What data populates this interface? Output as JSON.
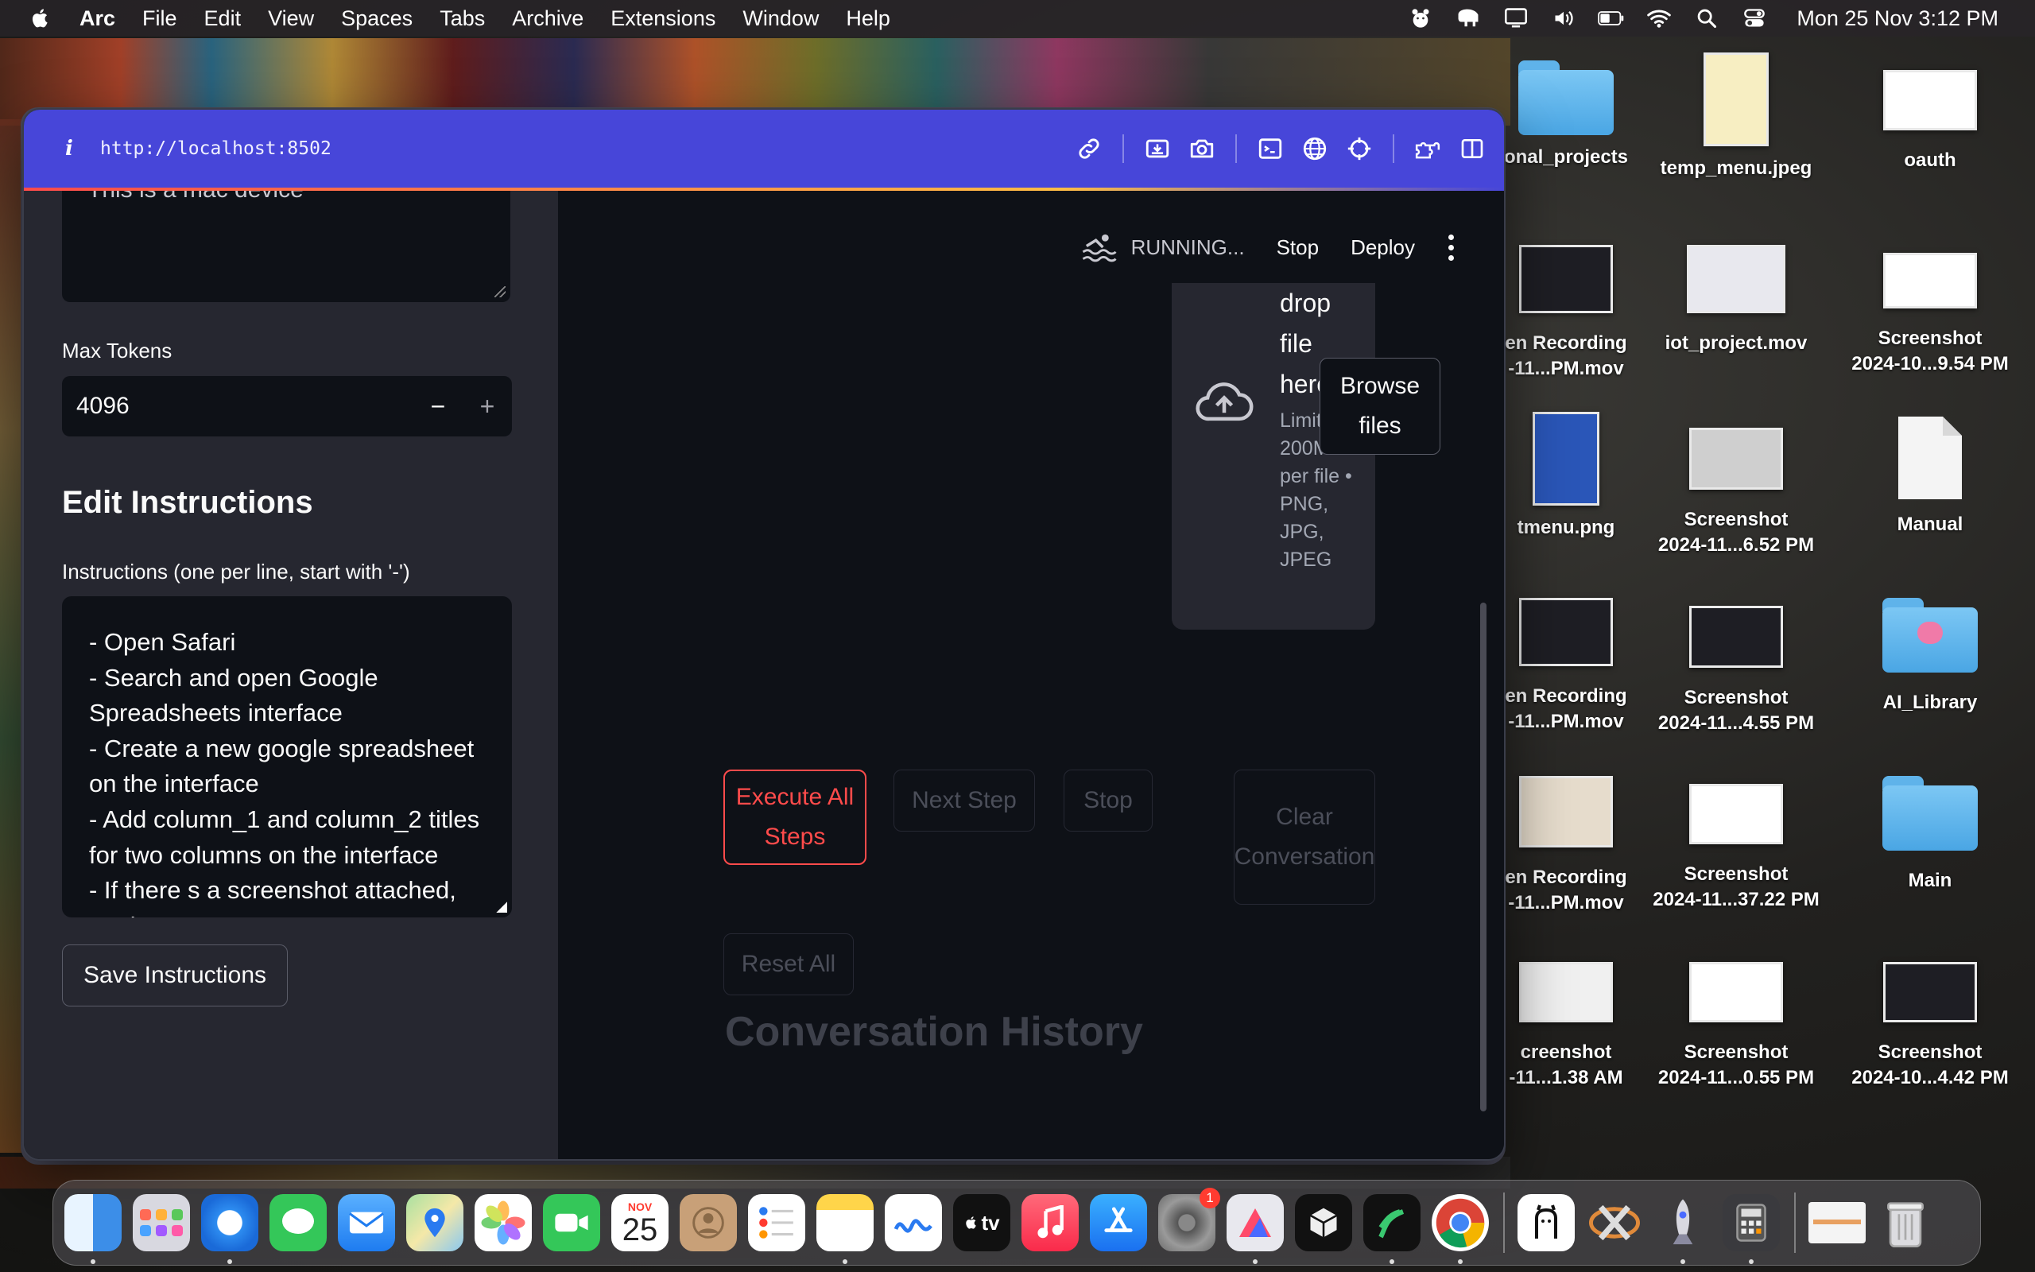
{
  "menubar": {
    "app_name": "Arc",
    "items": [
      "File",
      "Edit",
      "View",
      "Spaces",
      "Tabs",
      "Archive",
      "Extensions",
      "Window",
      "Help"
    ],
    "status_icons": [
      "bear-icon",
      "elephant-icon",
      "display-icon",
      "volume-icon",
      "battery-icon",
      "wifi-icon",
      "spotlight-search-icon",
      "control-center-icon"
    ],
    "clock": "Mon 25 Nov  3:12 PM"
  },
  "browser": {
    "url": "http://localhost:8502",
    "accent": "#4746d9",
    "tools": [
      "link-icon",
      "capture-icon",
      "camera-icon",
      "terminal-icon",
      "globe-icon",
      "crosshair-icon",
      "extensions-icon",
      "sidebar-toggle-icon"
    ]
  },
  "sidebar": {
    "prev_textarea_text": "This is a mac device",
    "max_tokens_label": "Max Tokens",
    "max_tokens_value": "4096",
    "minus": "−",
    "plus": "+",
    "section_title": "Edit Instructions",
    "instructions_label": "Instructions (one per line, start with '-')",
    "instructions_value": "- Open Safari\n- Search and open Google Spreadsheets interface\n- Create a new google spreadsheet on the interface\n- Add column_1 and column_2 titles for two columns on the interface\n- If there s a screenshot attached, analyze",
    "save_button": "Save Instructions"
  },
  "main": {
    "status": {
      "running": "RUNNING...",
      "stop": "Stop",
      "deploy": "Deploy"
    },
    "uploader": {
      "title": "drop file here",
      "limits": "Limit 200MB per file • PNG, JPG, JPEG",
      "browse": "Browse files"
    },
    "buttons": {
      "execute": "Execute All Steps",
      "next": "Next Step",
      "stop": "Stop",
      "clear": "Clear Conversation",
      "reset": "Reset All"
    },
    "conversation_title": "Conversation History",
    "primary_color": "#ff4b4b"
  },
  "desktop": {
    "icons": [
      {
        "name": "onal_projects",
        "kind": "folder"
      },
      {
        "name": "temp_menu.jpeg",
        "kind": "image"
      },
      {
        "name": "oauth",
        "kind": "screenshot"
      },
      {
        "name": "en Recording\n-11...PM.mov",
        "kind": "video"
      },
      {
        "name": "iot_project.mov",
        "kind": "video"
      },
      {
        "name": "Screenshot\n2024-10...9.54 PM",
        "kind": "screenshot"
      },
      {
        "name": "tmenu.png",
        "kind": "image"
      },
      {
        "name": "Screenshot\n2024-11...6.52 PM",
        "kind": "screenshot"
      },
      {
        "name": "Manual",
        "kind": "document"
      },
      {
        "name": "en Recording\n-11...PM.mov",
        "kind": "video"
      },
      {
        "name": "Screenshot\n2024-11...4.55 PM",
        "kind": "screenshot"
      },
      {
        "name": "AI_Library",
        "kind": "folder"
      },
      {
        "name": "en Recording\n-11...PM.mov",
        "kind": "video"
      },
      {
        "name": "Screenshot\n2024-11...37.22 PM",
        "kind": "screenshot"
      },
      {
        "name": "Main",
        "kind": "folder"
      },
      {
        "name": "creenshot\n-11...1.38 AM",
        "kind": "screenshot"
      },
      {
        "name": "Screenshot\n2024-11...0.55 PM",
        "kind": "screenshot"
      },
      {
        "name": "Screenshot\n2024-10...4.42 PM",
        "kind": "screenshot"
      }
    ]
  },
  "dock": {
    "calendar_month": "NOV",
    "calendar_day": "25",
    "tv_label": "tv",
    "settings_badge": "1",
    "apps": [
      "finder-icon",
      "launchpad-icon",
      "safari-icon",
      "messages-icon",
      "mail-icon",
      "maps-icon",
      "photos-icon",
      "facetime-icon",
      "calendar-icon",
      "contacts-icon",
      "reminders-icon",
      "notes-icon",
      "freeform-icon",
      "tv-icon",
      "music-icon",
      "app-store-icon",
      "system-settings-icon",
      "affinity-icon",
      "cube-icon",
      "bar-icon",
      "chrome-icon",
      "ollama-icon",
      "x-icon",
      "rocket-icon",
      "calculator-icon",
      "window-thumb-icon",
      "trash-icon"
    ]
  }
}
